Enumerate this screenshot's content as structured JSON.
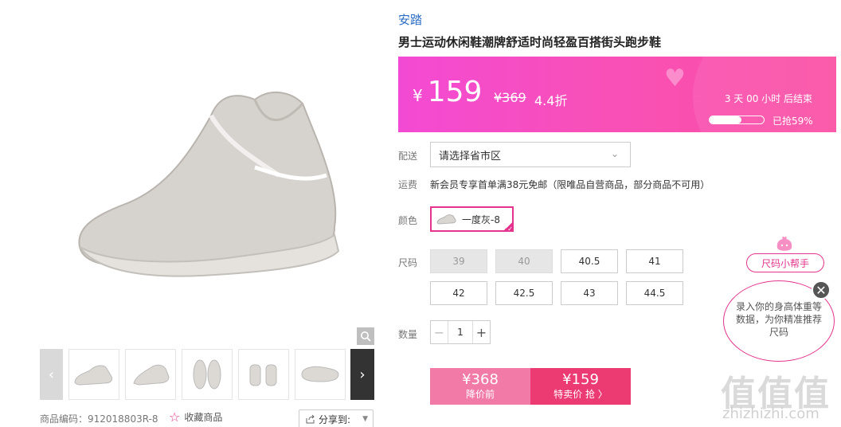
{
  "product": {
    "brand": "安踏",
    "title": "男士运动休闲鞋潮牌舒适时尚轻盈百搭街头跑步鞋",
    "code_label": "商品编码：912018803R-8",
    "favorite_label": "收藏商品",
    "share_label": "分享到:"
  },
  "price": {
    "currency": "¥",
    "current": "159",
    "original": "¥369",
    "discount": "4.4折",
    "countdown": "3  天  00  小时  后结束",
    "sold_percent": 0.59,
    "sold_label": "已抢59%"
  },
  "delivery": {
    "label": "配送",
    "placeholder": "请选择省市区"
  },
  "shipping": {
    "label": "运费",
    "text": "新会员专享首单满38元免邮（限唯品自营商品，部分商品不可用）"
  },
  "color": {
    "label": "颜色",
    "selected": "一度灰-8"
  },
  "size": {
    "label": "尺码",
    "options": [
      {
        "value": "39",
        "available": false
      },
      {
        "value": "40",
        "available": false
      },
      {
        "value": "40.5",
        "available": true
      },
      {
        "value": "41",
        "available": true
      },
      {
        "value": "42",
        "available": true
      },
      {
        "value": "42.5",
        "available": true
      },
      {
        "value": "43",
        "available": true
      },
      {
        "value": "44.5",
        "available": true
      }
    ]
  },
  "quantity": {
    "label": "数量",
    "value": "1",
    "minus": "−",
    "plus": "+"
  },
  "buy": {
    "original_price": "¥368",
    "original_label": "降价前",
    "sale_price": "¥159",
    "sale_label": "特卖价 抢 〉"
  },
  "size_helper": {
    "tag": "尺码小帮手",
    "bubble": "录入你的身高体重等数据，为你精准推荐尺码",
    "close": "✕"
  },
  "watermark": {
    "logo": "值值值",
    "url": "zhizhizhi.com"
  },
  "colors": {
    "accent": "#e4348d",
    "brand_link": "#2b6cc4",
    "buy_button": "#ec3b72"
  }
}
